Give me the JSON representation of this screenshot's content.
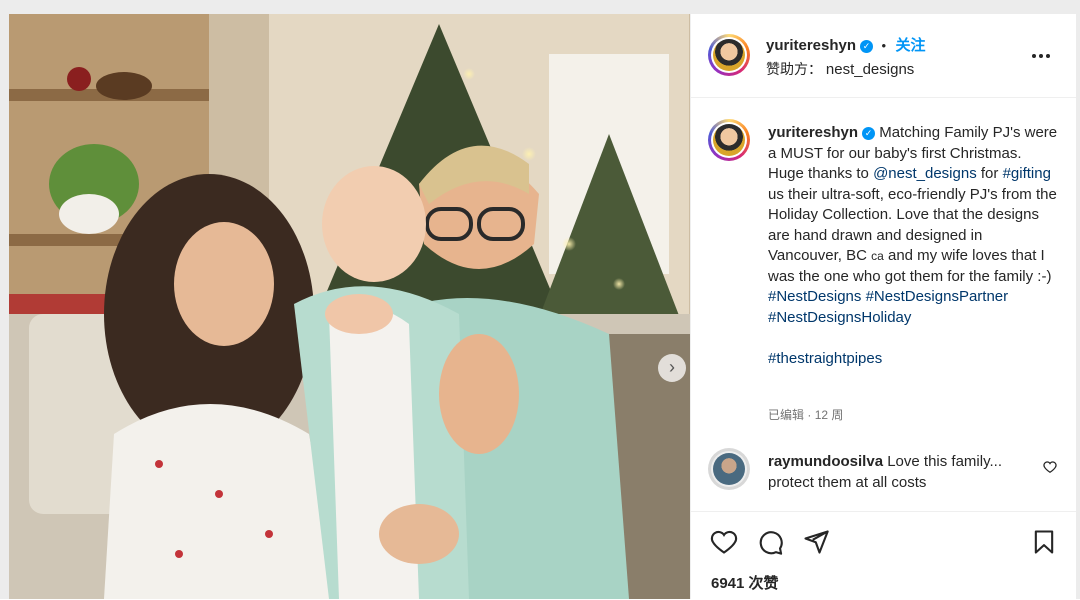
{
  "post": {
    "author": "yuritereshyn",
    "follow_label": "关注",
    "separator": "•",
    "sponsor_label": "赞助方：",
    "sponsor_name": "nest_designs",
    "more_icon": "more-horizontal-icon"
  },
  "caption": {
    "author": "yuritereshyn",
    "line1": "Matching Family PJ's were a MUST for our baby's first Christmas. Huge thanks to",
    "mention": "@nest_designs",
    "for": "for",
    "hashtag_gifting": "#gifting",
    "line2": "us their ultra-soft, eco-friendly PJ's from the Holiday Collection. Love that the designs are hand drawn and designed in Vancouver, BC",
    "ca_flag": "ca",
    "line3": "and my wife loves that I was the one who got them for the family :-)",
    "hashtags": [
      "#NestDesigns",
      "#NestDesignsPartner",
      "#NestDesignsHoliday"
    ],
    "hashtag_extra": "#thestraightpipes",
    "edited": "已编辑",
    "time": "12 周"
  },
  "comment": {
    "author": "raymundoosilva",
    "text": "Love this family... protect them at all costs"
  },
  "engagement": {
    "likes": "6941 次赞"
  },
  "colors": {
    "accent": "#0095f6",
    "link": "#00376b",
    "muted": "#737373"
  },
  "icons": [
    "verified-badge-icon",
    "heart-icon",
    "comment-icon",
    "share-icon",
    "bookmark-icon",
    "chevron-right-icon",
    "like-comment-heart-icon"
  ]
}
